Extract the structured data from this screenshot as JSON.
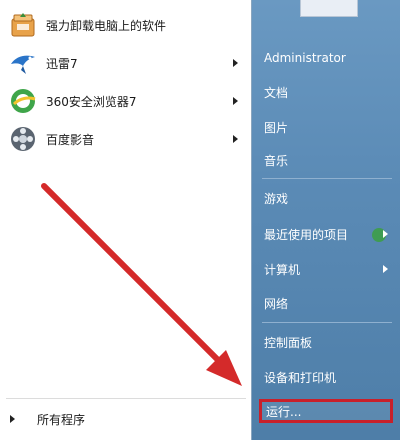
{
  "programs": [
    {
      "label": "强力卸载电脑上的软件",
      "icon": "uninstaller-box-icon",
      "has_submenu": false
    },
    {
      "label": "迅雷7",
      "icon": "thunder-bird-icon",
      "has_submenu": true
    },
    {
      "label": "360安全浏览器7",
      "icon": "360-browser-icon",
      "has_submenu": true
    },
    {
      "label": "百度影音",
      "icon": "baidu-video-reel-icon",
      "has_submenu": true
    }
  ],
  "all_programs_label": "所有程序",
  "right_menu": {
    "user": "Administrator",
    "items": [
      {
        "label": "文档",
        "has_submenu": false
      },
      {
        "label": "图片",
        "has_submenu": false
      },
      {
        "label": "音乐",
        "has_submenu": false
      },
      {
        "label": "游戏",
        "has_submenu": false
      },
      {
        "label": "最近使用的项目",
        "has_submenu": true
      },
      {
        "label": "计算机",
        "has_submenu": true
      },
      {
        "label": "网络",
        "has_submenu": false
      },
      {
        "label": "控制面板",
        "has_submenu": false
      },
      {
        "label": "设备和打印机",
        "has_submenu": false
      },
      {
        "label": "运行...",
        "has_submenu": false,
        "highlighted": true
      }
    ]
  },
  "colors": {
    "annotation_red": "#d42a2a",
    "highlight_border": "#c8202a",
    "right_pane_blue": "#5b8bb6"
  }
}
